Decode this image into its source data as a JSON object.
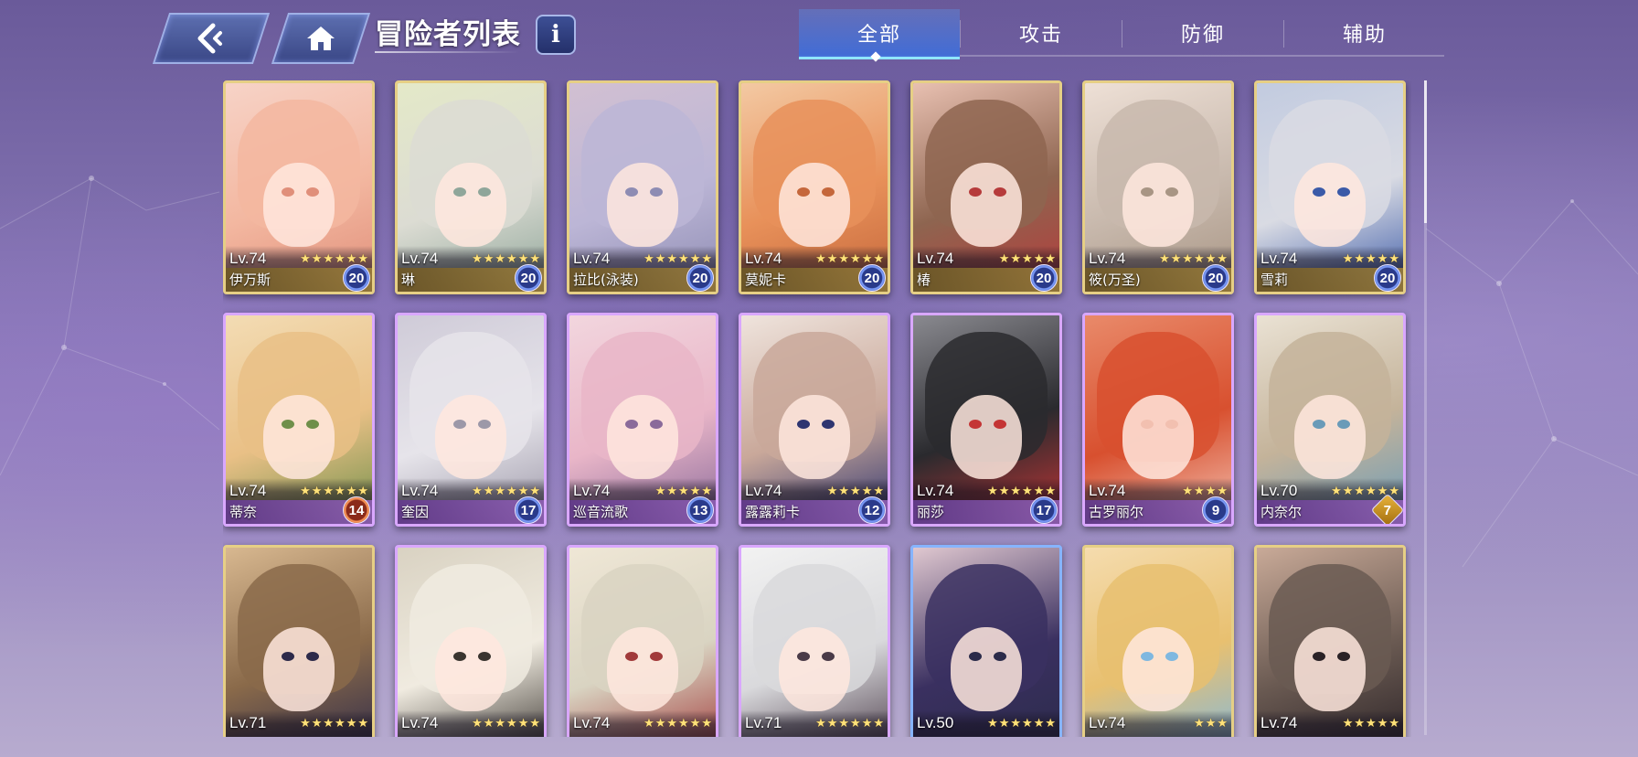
{
  "header": {
    "title": "冒险者列表",
    "info_label": "i"
  },
  "tabs": [
    {
      "label": "全部",
      "active": true
    },
    {
      "label": "攻击",
      "active": false
    },
    {
      "label": "防御",
      "active": false
    },
    {
      "label": "辅助",
      "active": false
    }
  ],
  "colors": {
    "gold_frame": "#e6cf85",
    "purple_frame": "#d9a7ff",
    "blue_frame": "#86b4ff",
    "star": "#ffe27a",
    "active_tab": "#3c6edc"
  },
  "cards": [
    {
      "level": "Lv.74",
      "stars": 6,
      "name": "伊万斯",
      "badge": "20",
      "frame": "gold",
      "palette": [
        "#f3b7a0",
        "#f7d3c7",
        "#e08f7a"
      ]
    },
    {
      "level": "Lv.74",
      "stars": 6,
      "name": "琳",
      "badge": "20",
      "frame": "gold",
      "palette": [
        "#dcdcd3",
        "#e4e9c8",
        "#8fa69a"
      ]
    },
    {
      "level": "Lv.74",
      "stars": 6,
      "name": "拉比(泳装)",
      "badge": "20",
      "frame": "gold",
      "palette": [
        "#bcb6d6",
        "#d2c0d2",
        "#8e8cb3"
      ]
    },
    {
      "level": "Lv.74",
      "stars": 6,
      "name": "莫妮卡",
      "badge": "20",
      "frame": "gold",
      "palette": [
        "#e8915a",
        "#f3c9a3",
        "#c5673b"
      ]
    },
    {
      "level": "Lv.74",
      "stars": 5,
      "name": "椿",
      "badge": "20",
      "frame": "gold",
      "palette": [
        "#8e6550",
        "#e8c0b1",
        "#b63b3b"
      ]
    },
    {
      "level": "Lv.74",
      "stars": 6,
      "name": "筱(万圣)",
      "badge": "20",
      "frame": "gold",
      "palette": [
        "#c8b9ad",
        "#eee0d6",
        "#a89584"
      ]
    },
    {
      "level": "Lv.74",
      "stars": 5,
      "name": "雪莉",
      "badge": "20",
      "frame": "gold",
      "palette": [
        "#d9dbe3",
        "#c2cbe0",
        "#3b5aa8"
      ]
    },
    {
      "level": "Lv.74",
      "stars": 6,
      "name": "蒂奈",
      "badge": "14",
      "frame": "purple",
      "palette": [
        "#e9c086",
        "#f3dcb4",
        "#6f8f4a"
      ]
    },
    {
      "level": "Lv.74",
      "stars": 6,
      "name": "奎因",
      "badge": "17",
      "frame": "purple",
      "palette": [
        "#e6e4ea",
        "#cfcbd8",
        "#9c98a8"
      ]
    },
    {
      "level": "Lv.74",
      "stars": 5,
      "name": "巡音流歌",
      "badge": "13",
      "frame": "purple",
      "palette": [
        "#e9b6c8",
        "#f2d6de",
        "#8a6a9a"
      ]
    },
    {
      "level": "Lv.74",
      "stars": 5,
      "name": "露露莉卡",
      "badge": "12",
      "frame": "purple",
      "palette": [
        "#c9a89a",
        "#efe4dd",
        "#2f3570"
      ]
    },
    {
      "level": "Lv.74",
      "stars": 6,
      "name": "丽莎",
      "badge": "17",
      "frame": "purple",
      "palette": [
        "#2a2a2e",
        "#8a8a90",
        "#c43535"
      ]
    },
    {
      "level": "Lv.74",
      "stars": 4,
      "name": "古罗丽尔",
      "badge": "9",
      "frame": "purple",
      "palette": [
        "#d8502f",
        "#e98a6a",
        "#f2c0b0"
      ]
    },
    {
      "level": "Lv.70",
      "stars": 6,
      "name": "内奈尔",
      "badge": "7",
      "frame": "purple",
      "palette": [
        "#c4b39a",
        "#eae2d4",
        "#6a9bb8"
      ]
    },
    {
      "level": "Lv.71",
      "stars": 6,
      "name": "",
      "badge": "",
      "frame": "gold",
      "palette": [
        "#8a6a4a",
        "#d8b890",
        "#2d2a4a"
      ]
    },
    {
      "level": "Lv.74",
      "stars": 6,
      "name": "",
      "badge": "",
      "frame": "purple",
      "palette": [
        "#f0ebe0",
        "#d9d2c2",
        "#3a3530"
      ]
    },
    {
      "level": "Lv.74",
      "stars": 6,
      "name": "",
      "badge": "",
      "frame": "purple",
      "palette": [
        "#d9d4c2",
        "#efe7d6",
        "#a13a3a"
      ]
    },
    {
      "level": "Lv.71",
      "stars": 6,
      "name": "",
      "badge": "",
      "frame": "purple",
      "palette": [
        "#d9d9dc",
        "#f2f2f2",
        "#4a3b48"
      ]
    },
    {
      "level": "Lv.50",
      "stars": 6,
      "name": "",
      "badge": "",
      "frame": "blue",
      "palette": [
        "#3a3060",
        "#e0c8d0",
        "#2b2b4a"
      ]
    },
    {
      "level": "Lv.74",
      "stars": 3,
      "name": "",
      "badge": "",
      "frame": "gold",
      "palette": [
        "#e8c070",
        "#f5dcae",
        "#7fb8e0"
      ]
    },
    {
      "level": "Lv.74",
      "stars": 5,
      "name": "",
      "badge": "",
      "frame": "gold",
      "palette": [
        "#6a5a52",
        "#c9aa98",
        "#2a2226"
      ]
    }
  ]
}
